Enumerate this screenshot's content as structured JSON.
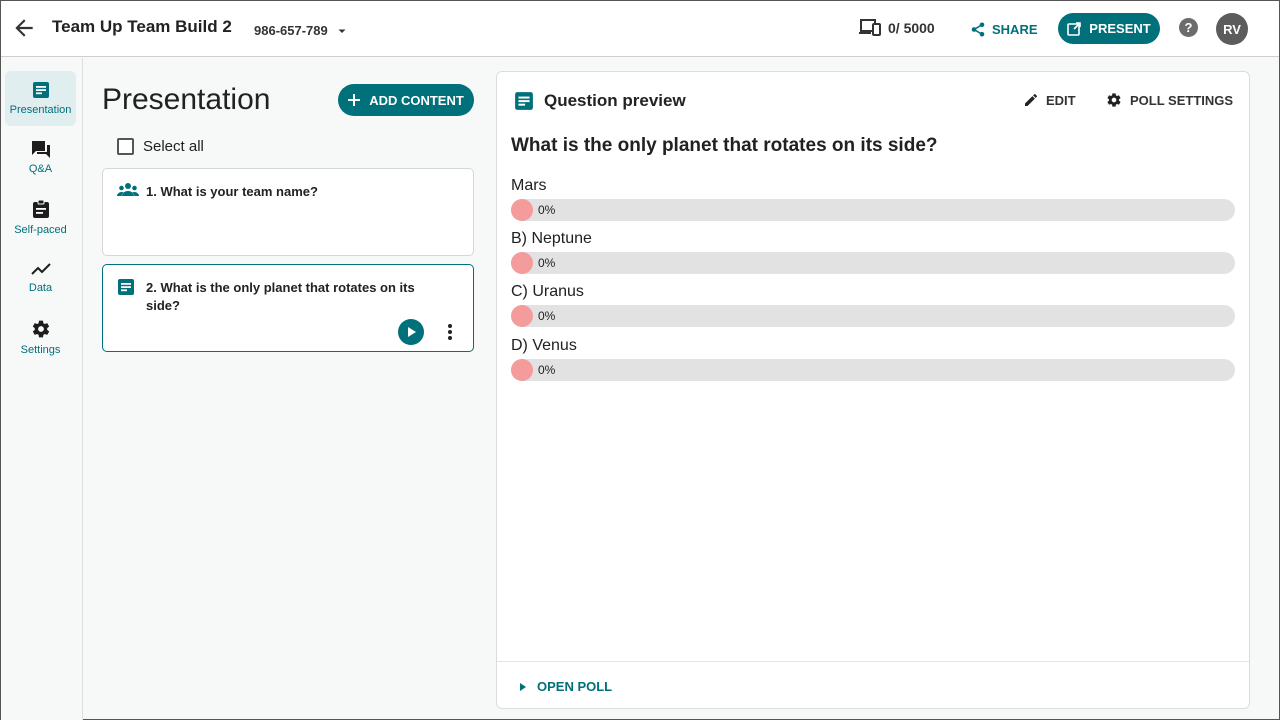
{
  "header": {
    "title": "Team Up Team Build 2",
    "session_code": "986-657-789",
    "audience_count": "0/ 5000",
    "share_label": "SHARE",
    "present_label": "PRESENT",
    "help_label": "?",
    "avatar_initials": "RV"
  },
  "sidebar": {
    "items": [
      {
        "label": "Presentation",
        "icon": "document-icon",
        "active": true
      },
      {
        "label": "Q&A",
        "icon": "chat-icon",
        "active": false
      },
      {
        "label": "Self-paced",
        "icon": "clipboard-icon",
        "active": false
      },
      {
        "label": "Data",
        "icon": "trend-chart-icon",
        "active": false
      },
      {
        "label": "Settings",
        "icon": "gear-icon",
        "active": false
      }
    ]
  },
  "content_list": {
    "title": "Presentation",
    "add_content_label": "ADD CONTENT",
    "select_all_label": "Select all",
    "cards": [
      {
        "text": "1. What is your team name?",
        "icon": "team-icon",
        "selected": false
      },
      {
        "text": "2. What is the only planet that rotates on its side?",
        "icon": "poll-icon",
        "selected": true
      }
    ]
  },
  "preview": {
    "title": "Question preview",
    "edit_label": "EDIT",
    "poll_settings_label": "POLL SETTINGS",
    "question": "What is the only planet that rotates on its side?",
    "options": [
      {
        "label": "Mars",
        "percent": "0%",
        "value": 0
      },
      {
        "label": "B) Neptune",
        "percent": "0%",
        "value": 0
      },
      {
        "label": "C) Uranus",
        "percent": "0%",
        "value": 0
      },
      {
        "label": "D) Venus",
        "percent": "0%",
        "value": 0
      }
    ],
    "open_poll_label": "OPEN POLL"
  },
  "colors": {
    "accent": "#00707a",
    "bar_fill": "#f49b9b",
    "bar_track": "#e2e2e2"
  }
}
